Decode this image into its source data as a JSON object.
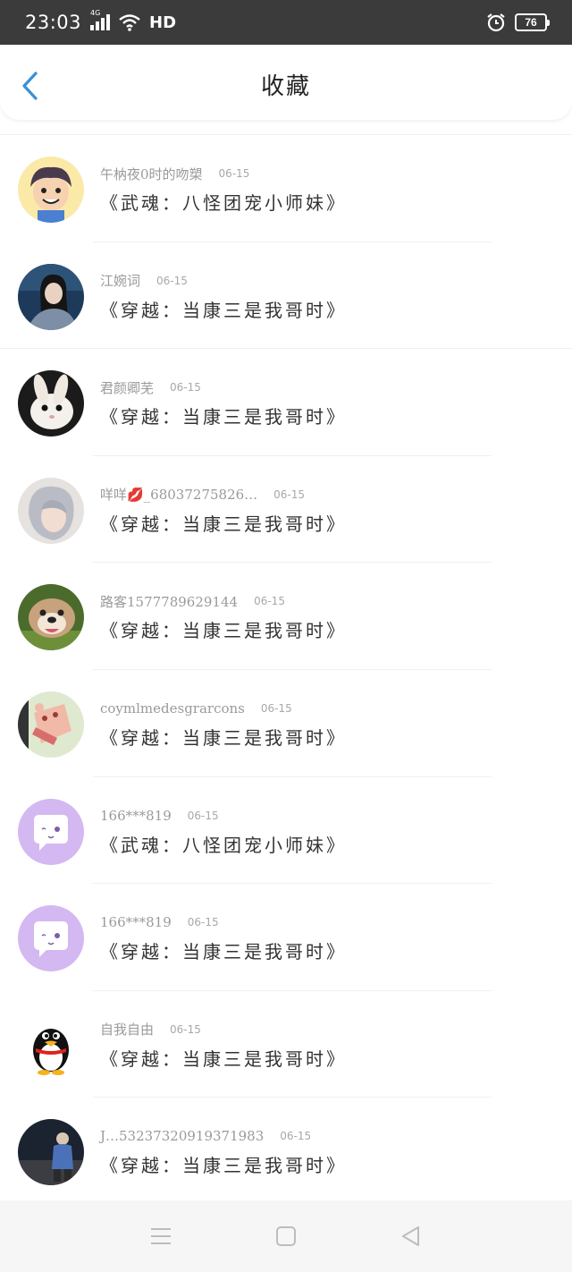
{
  "status": {
    "time": "23:03",
    "network": "4G",
    "hd": "HD",
    "battery": "76"
  },
  "header": {
    "title": "收藏"
  },
  "items": [
    {
      "user": "午枘夜0时的吻槊",
      "date": "06-15",
      "book": "《武魂：八怪团宠小师妹》",
      "avatar": "cartoon-boy"
    },
    {
      "user": "江婉词",
      "date": "06-15",
      "book": "《穿越：当康三是我哥时》",
      "avatar": "girl-photo"
    },
    {
      "user": "君颜卿芜",
      "date": "06-15",
      "book": "《穿越：当康三是我哥时》",
      "avatar": "rabbit"
    },
    {
      "user": "咩咩💋_68037275826…",
      "date": "06-15",
      "book": "《穿越：当康三是我哥时》",
      "avatar": "silver-hair-girl"
    },
    {
      "user": "路客1577789629144",
      "date": "06-15",
      "book": "《穿越：当康三是我哥时》",
      "avatar": "bulldog"
    },
    {
      "user": "coymlmedesgrarcons",
      "date": "06-15",
      "book": "《穿越：当康三是我哥时》",
      "avatar": "plush-doll"
    },
    {
      "user": "166***819",
      "date": "06-15",
      "book": "《武魂：八怪团宠小师妹》",
      "avatar": "chat-bubble"
    },
    {
      "user": "166***819",
      "date": "06-15",
      "book": "《穿越：当康三是我哥时》",
      "avatar": "chat-bubble"
    },
    {
      "user": "自我自由",
      "date": "06-15",
      "book": "《穿越：当康三是我哥时》",
      "avatar": "penguin"
    },
    {
      "user": "J…53237320919371983",
      "date": "06-15",
      "book": "《穿越：当康三是我哥时》",
      "avatar": "night-person"
    }
  ],
  "colors": {
    "accent": "#3b8fd8",
    "status_bar": "#3b3b3b",
    "bubble_purple": "#d4b8f2"
  }
}
